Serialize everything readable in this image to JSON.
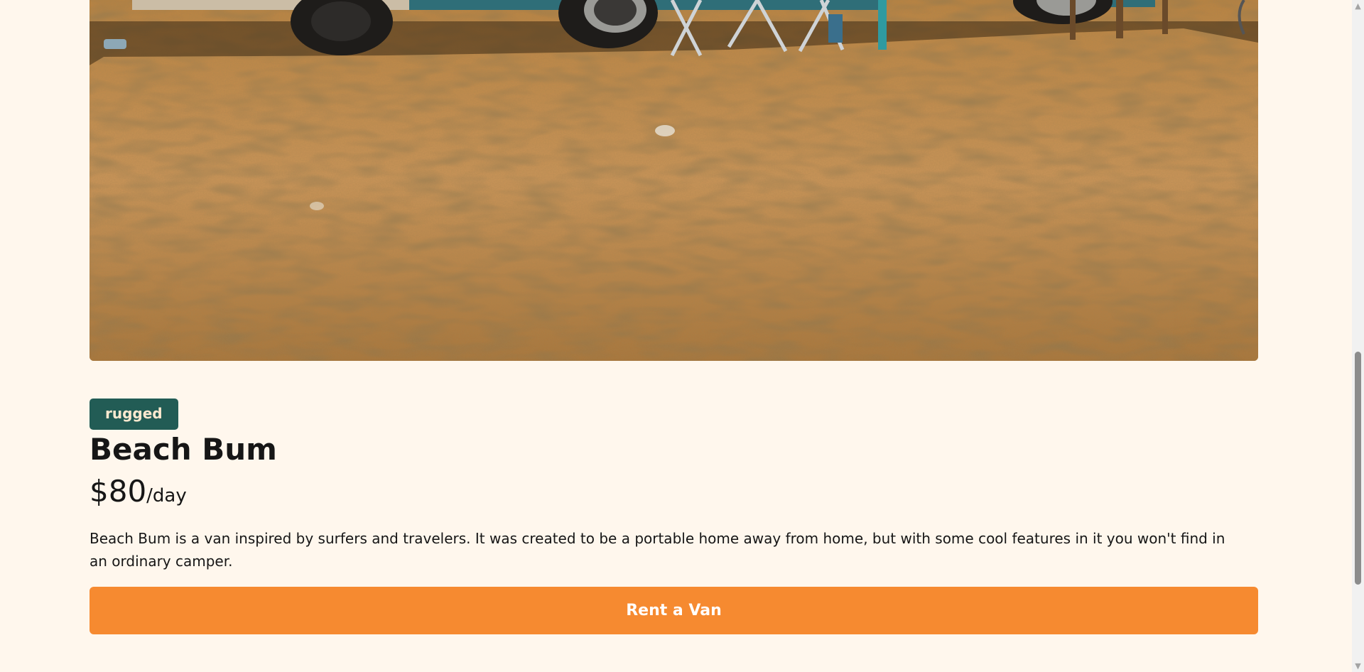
{
  "van": {
    "type_badge": "rugged",
    "name": "Beach Bum",
    "price": "$80",
    "price_unit": "/day",
    "description": "Beach Bum is a van inspired by surfers and travelers. It was created to be a portable home away from home, but with some cool features in it you won't find in an ordinary camper.",
    "cta_label": "Rent a Van"
  },
  "colors": {
    "background": "#FFF7ED",
    "badge_rugged": "#225C55",
    "cta": "#F68A30",
    "text": "#161616"
  },
  "scrollbar": {
    "up_icon": "triangle-up-icon",
    "down_icon": "triangle-down-icon"
  }
}
